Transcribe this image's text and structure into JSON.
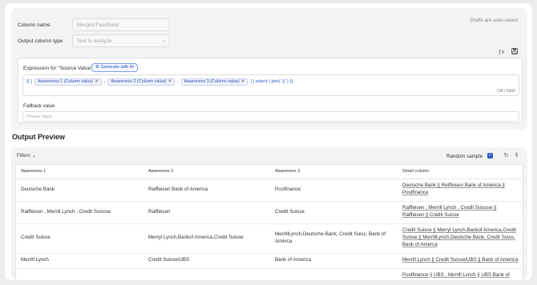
{
  "settings": {
    "column_name_label": "Column name",
    "column_name_placeholder": "Merged Feedback",
    "output_type_label": "Output column type",
    "output_type_placeholder": "Text to analyze",
    "autosave_text": "Drafts are auto-saved",
    "expression_label": "Expression for \"Source Value\"",
    "generate_ai_label": "Generate with AI",
    "expression_open": "{{ [",
    "chips": [
      "Awareness 1 (Column value)",
      "Awareness 2 (Column value)",
      "Awareness 3 (Column value)"
    ],
    "chip_separator": ",",
    "expression_tail": "] | select | join(' || ') }}",
    "char_counter": "138 / 5000",
    "fallback_label": "Fallback value",
    "fallback_placeholder": "Please input"
  },
  "preview": {
    "title": "Output Preview",
    "filters_label": "Filters",
    "random_sample_label": "Random sample",
    "random_sample_checked": true,
    "columns": [
      "Awareness 1",
      "Awareness 2",
      "Awareness 3",
      "Smart column"
    ],
    "rows": [
      [
        "Deutsche Bank",
        "Reiffeisen Bank of America",
        "Postfinance",
        "Deutsche Bank || Reiffeisen Bank of America || Postfinance"
      ],
      [
        "Raiffeisen , Merrill Lynch , Credit Suissse",
        "Raiffeisen",
        "Credit Suisse",
        "Raiffeisen , Merrill Lynch , Credit Suissse || Raiffeisen || Credit Suisse"
      ],
      [
        "Credit Suisse",
        "Merryl Lynch,Bankof America,Credit Suisse",
        "MerrillLynch,Deutsche Bank, Credit Suiss, Bank of Amerca",
        "Credit Suisse || Merryl Lynch,Bankof America,Credit Suisse || MerrillLynch,Deutsche Bank, Credit Suiss, Bank of Amerca"
      ],
      [
        "Merrill Lynch",
        "Credit Suisse/UBS",
        "Bank of America",
        "Merrill Lynch || Credit Suisse/UBS || Bank of America"
      ],
      [
        "",
        "",
        "",
        "Postfinance || UBS , Merrill Lynch || UBS Bank of"
      ]
    ]
  },
  "icons": {
    "function": "fx-icon",
    "save": "save-icon",
    "refresh": "refresh-icon",
    "columns": "columns-icon"
  },
  "colors": {
    "accent": "#2f5fd0",
    "expression_text": "#2b55c8"
  }
}
